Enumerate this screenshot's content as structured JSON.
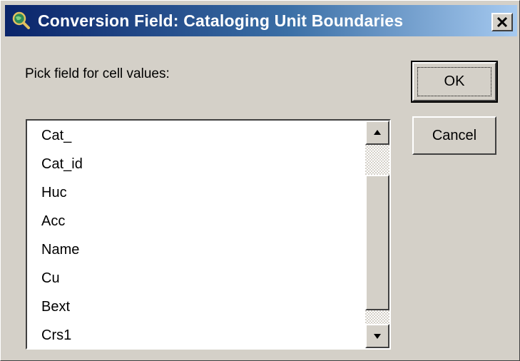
{
  "window": {
    "title": "Conversion Field: Cataloging Unit Boundaries",
    "icon": "globe-magnifier-icon"
  },
  "prompt": "Pick field for cell values:",
  "field_list": {
    "items": [
      "Cat_",
      "Cat_id",
      "Huc",
      "Acc",
      "Name",
      "Cu",
      "Bext",
      "Crs1"
    ],
    "selected_index": null
  },
  "buttons": {
    "ok_label": "OK",
    "cancel_label": "Cancel"
  },
  "colors": {
    "face": "#d4d0c8",
    "title_start": "#0a246a",
    "title_end": "#a6caf0",
    "title_text": "#ffffff"
  }
}
